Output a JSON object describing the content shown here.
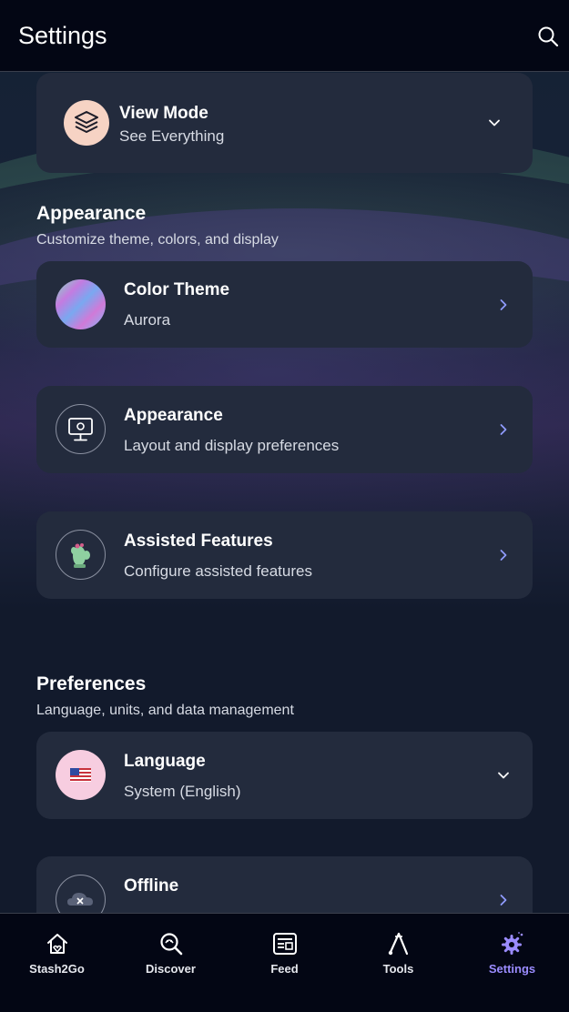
{
  "header": {
    "title": "Settings",
    "search_icon": "search-icon"
  },
  "view_mode": {
    "title": "View Mode",
    "value": "See Everything",
    "icon": "layers-icon"
  },
  "appearance_section": {
    "title": "Appearance",
    "subtitle": "Customize theme, colors, and display",
    "items": [
      {
        "title": "Color Theme",
        "subtitle": "Aurora",
        "icon": "aurora-swatch-icon"
      },
      {
        "title": "Appearance",
        "subtitle": "Layout and display preferences",
        "icon": "monitor-icon"
      },
      {
        "title": "Assisted Features",
        "subtitle": "Configure assisted features",
        "icon": "cactus-icon"
      }
    ]
  },
  "preferences_section": {
    "title": "Preferences",
    "subtitle": "Language, units, and data management",
    "items": [
      {
        "title": "Language",
        "subtitle": "System (English)",
        "icon": "us-flag-icon"
      },
      {
        "title": "Offline",
        "subtitle": "",
        "icon": "cloud-offline-icon"
      }
    ]
  },
  "bottom_nav": {
    "items": [
      {
        "label": "Stash2Go",
        "icon": "home-icon",
        "active": false
      },
      {
        "label": "Discover",
        "icon": "discover-icon",
        "active": false
      },
      {
        "label": "Feed",
        "icon": "feed-icon",
        "active": false
      },
      {
        "label": "Tools",
        "icon": "tools-icon",
        "active": false
      },
      {
        "label": "Settings",
        "icon": "settings-gear-icon",
        "active": true
      }
    ]
  },
  "colors": {
    "card_bg": "#232b3d",
    "header_bg": "#030614",
    "accent": "#9b8cff",
    "chevron": "#8f9bff"
  }
}
